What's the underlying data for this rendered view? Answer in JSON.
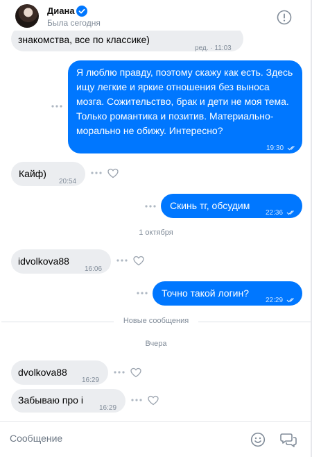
{
  "header": {
    "contact_name": "Диана",
    "status": "Была сегодня",
    "accent_color": "#0077ff"
  },
  "messages": [
    {
      "text": "знакомства, все по классике)",
      "meta": "ред. · 11:03"
    },
    {
      "text": "Я люблю правду, поэтому скажу как есть. Здесь ищу легкие и яркие отношения без выноса мозга. Сожительство, брак и дети не моя тема. Только романтика и позитив. Материально-морально не обижу. Интересно?",
      "time": "19:30"
    },
    {
      "text": "Кайф)",
      "time": "20:54"
    },
    {
      "text": "Скинь тг, обсудим",
      "time": "22:36"
    },
    {
      "text": "idvolkova88",
      "time": "16:06"
    },
    {
      "text": "Точно такой логин?",
      "time": "22:29"
    },
    {
      "text": "dvolkova88",
      "time": "16:29"
    },
    {
      "text": "Забываю про i",
      "time": "16:29"
    }
  ],
  "separators": {
    "date_oct": "1 октября",
    "new_messages": "Новые сообщения",
    "yesterday": "Вчера"
  },
  "composer": {
    "placeholder": "Сообщение"
  },
  "icons": [
    "verified-icon",
    "info-icon",
    "more-dots-icon",
    "heart-icon",
    "read-ticks-icon",
    "emoji-icon",
    "chat-send-icon"
  ]
}
